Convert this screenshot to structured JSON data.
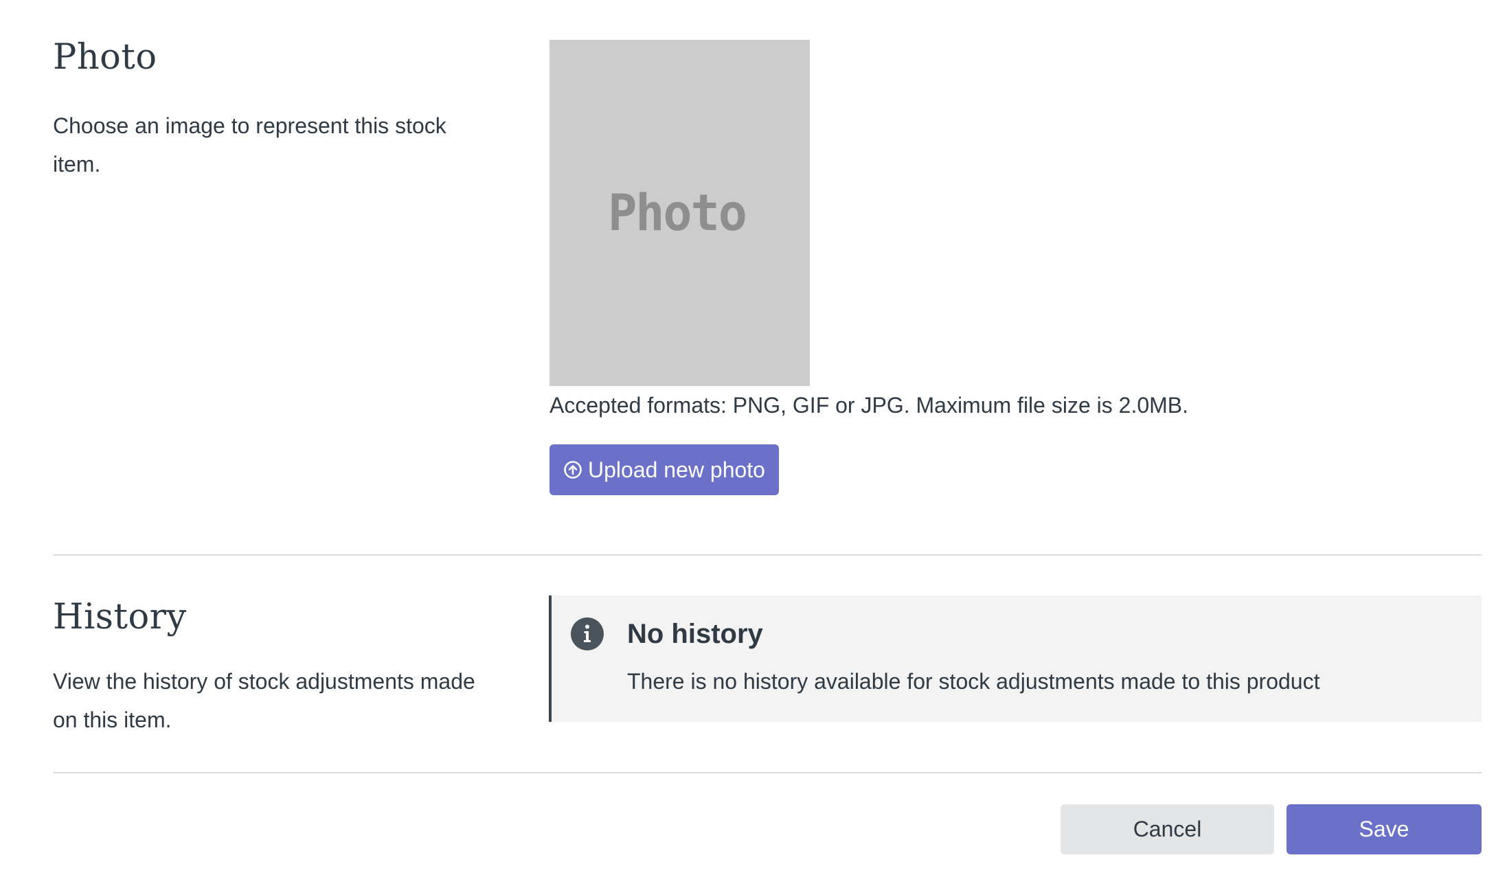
{
  "photo_section": {
    "title": "Photo",
    "description": "Choose an image to represent this stock item.",
    "placeholder_label": "Photo",
    "accepted_formats": "Accepted formats: PNG, GIF or JPG. Maximum file size is 2.0MB.",
    "upload_button": {
      "label": "Upload new photo",
      "icon": "upload-circle-arrow-icon"
    }
  },
  "history_section": {
    "title": "History",
    "description": "View the history of stock adjustments made on this item.",
    "notice": {
      "icon": "info-icon",
      "title": "No history",
      "body": "There is no history available for stock adjustments made to this product"
    }
  },
  "footer": {
    "cancel_label": "Cancel",
    "save_label": "Save"
  },
  "colors": {
    "primary": "#6b70c9",
    "text": "#2f3a44",
    "placeholder_bg": "#cccccc",
    "notice_bg": "#f3f3f3",
    "secondary_button_bg": "#e4e5e7"
  }
}
